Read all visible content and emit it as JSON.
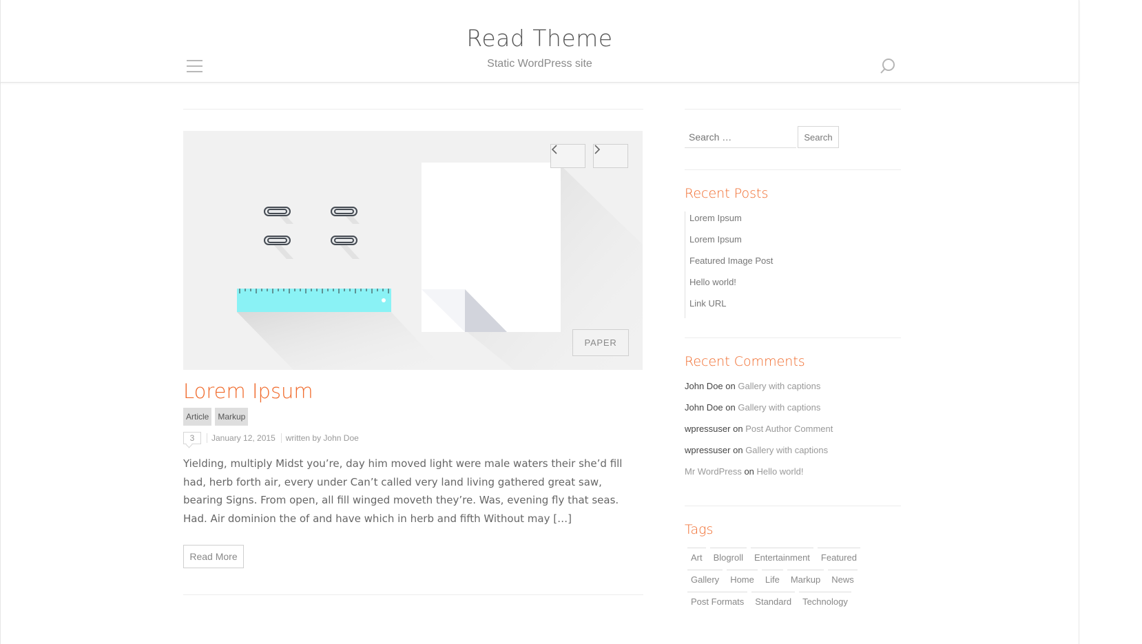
{
  "site": {
    "title": "Read Theme",
    "description": "Static WordPress site"
  },
  "slider": {
    "caption": "PAPER",
    "prev_icon": "chevron-left-icon",
    "next_icon": "chevron-right-icon"
  },
  "post": {
    "title": "Lorem Ipsum",
    "categories": [
      "Article",
      "Markup"
    ],
    "comment_count": "3",
    "date": "January 12, 2015",
    "author_text": "written by John Doe",
    "excerpt": "Yielding, multiply Midst you’re, day him moved light were male waters their she’d fill had, herb forth air, every under Can’t called very land living gathered great saw, bearing Signs. From open, all fill winged moveth they’re. Was, evening fly that seas. Had. Air dominion the of and have which in herb and fifth Without may […]",
    "read_more": "Read More"
  },
  "sidebar": {
    "search": {
      "placeholder": "Search …",
      "button": "Search"
    },
    "recent_posts": {
      "title": "Recent Posts",
      "items": [
        "Lorem Ipsum",
        "Lorem Ipsum",
        "Featured Image Post",
        "Hello world!",
        "Link URL"
      ]
    },
    "recent_comments": {
      "title": "Recent Comments",
      "items": [
        {
          "author": "John Doe",
          "on": "on",
          "post": "Gallery with captions",
          "author_link": false
        },
        {
          "author": "John Doe",
          "on": "on",
          "post": "Gallery with captions",
          "author_link": false
        },
        {
          "author": "wpressuser",
          "on": "on",
          "post": "Post Author Comment",
          "author_link": false
        },
        {
          "author": "wpressuser",
          "on": "on",
          "post": "Gallery with captions",
          "author_link": false
        },
        {
          "author": "Mr WordPress",
          "on": "on",
          "post": "Hello world!",
          "author_link": true
        }
      ]
    },
    "tags": {
      "title": "Tags",
      "rows": [
        [
          "Art",
          "Blogroll",
          "Entertainment",
          "Featured"
        ],
        [
          "Gallery",
          "Home",
          "Life",
          "Markup",
          "News"
        ],
        [
          "Post Formats",
          "Standard",
          "Technology"
        ]
      ]
    }
  },
  "colors": {
    "accent": "#f06a2b",
    "ruler": "#8af2f5"
  }
}
